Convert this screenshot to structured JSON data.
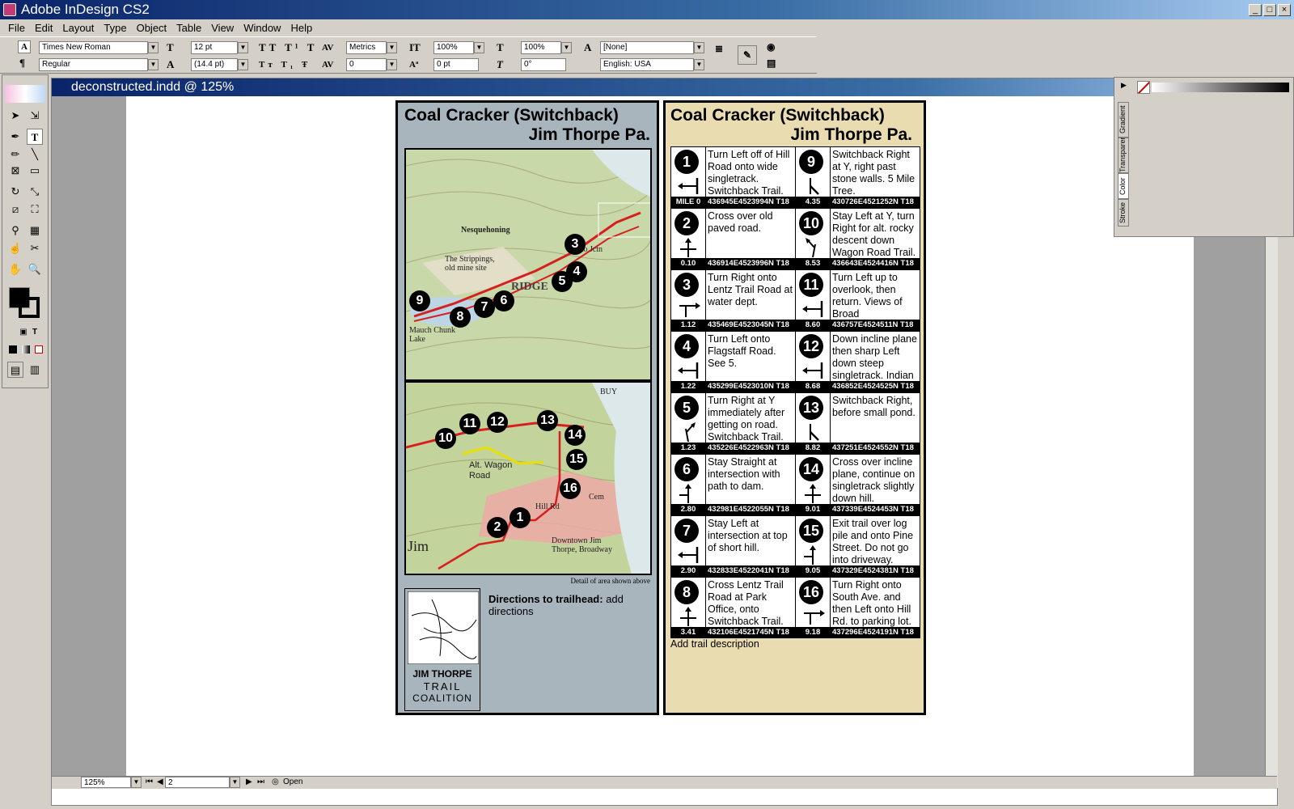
{
  "app": {
    "title": "Adobe InDesign CS2"
  },
  "menu": [
    "File",
    "Edit",
    "Layout",
    "Type",
    "Object",
    "Table",
    "View",
    "Window",
    "Help"
  ],
  "control": {
    "font_family": "Times New Roman",
    "font_style": "Regular",
    "font_size": "12 pt",
    "leading": "(14.4 pt)",
    "kerning": "Metrics",
    "tracking": "0",
    "v_scale": "100%",
    "h_scale": "100%",
    "baseline": "0 pt",
    "skew": "0°",
    "char_style": "[None]",
    "language": "English: USA"
  },
  "document": {
    "title": "deconstructed.indd @ 125%"
  },
  "status": {
    "zoom": "125%",
    "page": "2",
    "open_label": "Open"
  },
  "panel": {
    "tabs": [
      "Stroke",
      "Color",
      "Transparency",
      "Gradient"
    ]
  },
  "card_left": {
    "title_line1": "Coal Cracker (Switchback)",
    "title_line2": "Jim Thorpe Pa.",
    "map_labels": [
      "Nesquehoning",
      "The Strippings, old mine site",
      "Mauch Chunk Lake",
      "Hauto Jctn",
      "RIDGE",
      "Alt. Wagon Road",
      "Hill Rd",
      "Downtown Jim Thorpe, Broadway",
      "Jim",
      "BUY",
      "Cem"
    ],
    "detail_caption": "Detail of area shown above",
    "logo_line1": "JIM THORPE",
    "logo_line2": "TRAIL",
    "logo_line3": "COALITION",
    "directions_bold": "Directions to trailhead:",
    "directions_text": " add directions"
  },
  "card_right": {
    "title_line1": "Coal Cracker (Switchback)",
    "title_line2": "Jim Thorpe Pa.",
    "trail_description": "Add trail description",
    "cues": [
      {
        "n": "1",
        "text": "Turn Left off of Hill Road onto wide singletrack. Switchback Trail.",
        "mile": "MILE 0",
        "coord": "436945E4523994N T18",
        "arrow": "left"
      },
      {
        "n": "2",
        "text": "Cross over old paved road.",
        "mile": "0.10",
        "coord": "436914E4523996N T18",
        "arrow": "cross"
      },
      {
        "n": "3",
        "text": "Turn Right onto Lentz Trail Road at water dept.",
        "mile": "1.12",
        "coord": "435469E4523045N T18",
        "arrow": "right"
      },
      {
        "n": "4",
        "text": "Turn Left onto Flagstaff Road. See 5.",
        "mile": "1.22",
        "coord": "435299E4523010N T18",
        "arrow": "left"
      },
      {
        "n": "5",
        "text": "Turn Right at Y immediately after getting on road. Switchback Trail.",
        "mile": "1.23",
        "coord": "435226E4522963N T18",
        "arrow": "yright"
      },
      {
        "n": "6",
        "text": "Stay Straight at intersection with path to dam.",
        "mile": "2.80",
        "coord": "432981E4522055N T18",
        "arrow": "straight"
      },
      {
        "n": "7",
        "text": "Stay Left at intersection at top of short hill.",
        "mile": "2.90",
        "coord": "432833E4522041N T18",
        "arrow": "left"
      },
      {
        "n": "8",
        "text": "Cross Lentz Trail Road at Park Office, onto Switchback Trail.",
        "mile": "3.41",
        "coord": "432106E4521745N T18",
        "arrow": "cross"
      },
      {
        "n": "9",
        "text": "Switchback Right at Y, right past stone walls. 5 Mile Tree.",
        "mile": "4.35",
        "coord": "430726E4521252N T18",
        "arrow": "switch"
      },
      {
        "n": "10",
        "text": "Stay Left at Y, turn Right for alt. rocky descent down Wagon Road Trail.",
        "mile": "8.53",
        "coord": "436643E4524416N T18",
        "arrow": "yleft"
      },
      {
        "n": "11",
        "text": "Turn Left up to overlook, then return. Views of Broad Mt./L.Gorge.",
        "mile": "8.60",
        "coord": "436757E4524511N T18",
        "arrow": "left"
      },
      {
        "n": "12",
        "text": "Down incline plane then sharp Left down steep singletrack. Indian Path.",
        "mile": "8.68",
        "coord": "436852E4524525N T18",
        "arrow": "left"
      },
      {
        "n": "13",
        "text": "Switchback Right, before small pond.",
        "mile": "8.82",
        "coord": "437251E4524552N T18",
        "arrow": "switch"
      },
      {
        "n": "14",
        "text": "Cross over incline plane, continue on singletrack slightly down hill.",
        "mile": "9.01",
        "coord": "437339E4524453N T18",
        "arrow": "cross"
      },
      {
        "n": "15",
        "text": "Exit trail over log pile and onto Pine Street. Do not go into driveway.",
        "mile": "9.05",
        "coord": "437329E4524381N T18",
        "arrow": "straight"
      },
      {
        "n": "16",
        "text": "Turn Right onto South Ave. and then Left onto Hill Rd. to parking lot.",
        "mile": "9.18",
        "coord": "437296E4524191N T18",
        "arrow": "right"
      }
    ]
  },
  "colors": {
    "left_bg": "#a8b5bd",
    "right_bg": "#e9dcb0",
    "trail": "#d62020",
    "alt_trail": "#e8e000"
  }
}
